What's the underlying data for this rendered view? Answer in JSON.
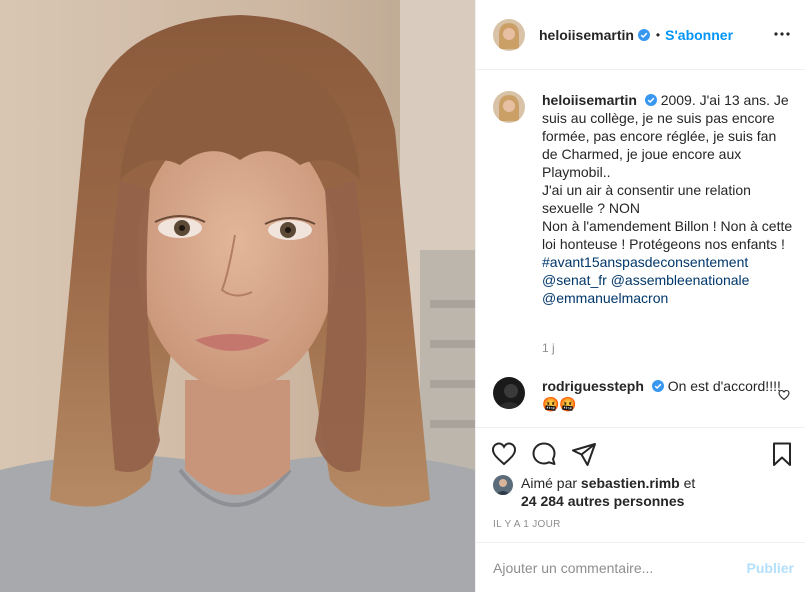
{
  "header": {
    "username": "heloiisemartin",
    "separator": "•",
    "follow_label": "S'abonner",
    "more_icon": "more-horizontal-icon"
  },
  "caption": {
    "username": "heloiisemartin",
    "text_lines": [
      "2009. J'ai 13 ans. Je suis au collège, je ne suis pas encore formée, pas encore réglée, je suis fan de Charmed, je joue encore aux Playmobil..",
      "J'ai un air à consentir une relation sexuelle ? NON",
      "Non à l'amendement Billon ! Non à cette loi honteuse ! Protégeons nos enfants !"
    ],
    "hashtag": "#avant15anspasdeconsentement",
    "mention_1": "@senat_fr",
    "mention_2": "@assembleenationale",
    "mention_3": "@emmanuelmacron",
    "time": "1 j"
  },
  "comment": {
    "username": "rodriguessteph",
    "text": "On est d'accord!!!! 🤬🤬"
  },
  "actions": {
    "like_icon": "heart-icon",
    "comment_icon": "comment-bubble-icon",
    "share_icon": "paper-plane-icon",
    "save_icon": "bookmark-icon"
  },
  "likes": {
    "prefix": "Aimé par",
    "user": "sebastien.rimb",
    "and": "et",
    "count": "24 284 autres personnes"
  },
  "posted_time": "IL Y A 1 JOUR",
  "composer": {
    "placeholder": "Ajouter un commentaire...",
    "publish_label": "Publier"
  },
  "colors": {
    "accent": "#0095f6",
    "link": "#00376b",
    "muted": "#8e8e8e",
    "verified": "#3897f0",
    "publish_disabled": "#b2dffc"
  }
}
